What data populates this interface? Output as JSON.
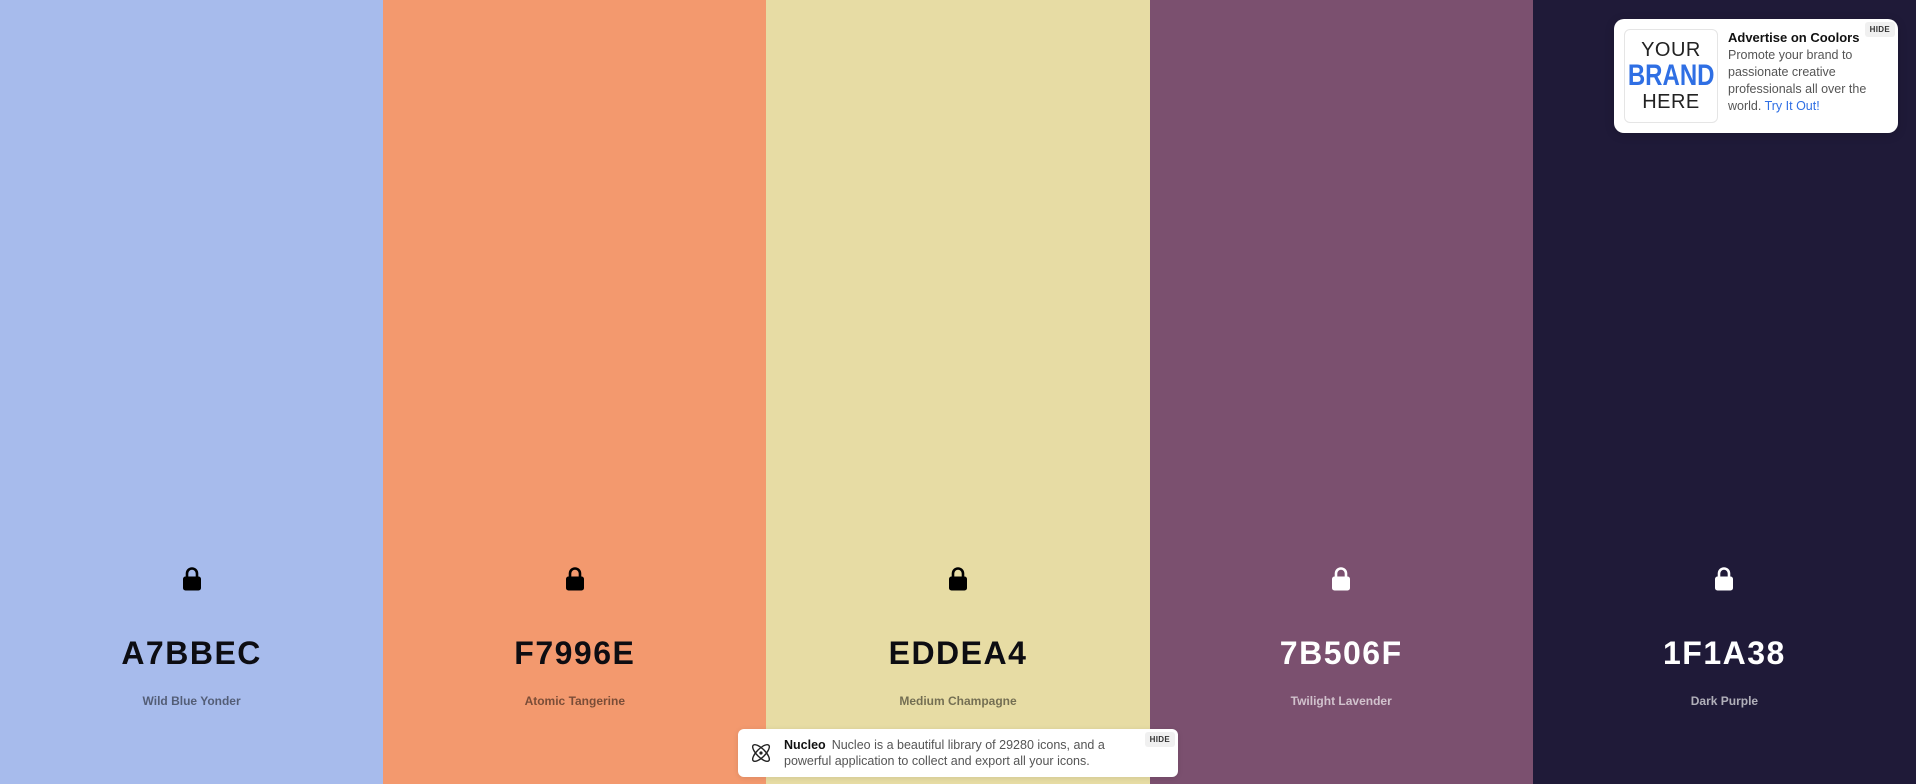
{
  "palette": {
    "swatches": [
      {
        "hex": "A7BBEC",
        "name": "Wild Blue Yonder",
        "color": "#A7BBEC",
        "text_theme": "dark",
        "locked": false
      },
      {
        "hex": "F7996E",
        "name": "Atomic Tangerine",
        "color": "#F3996E",
        "text_theme": "dark",
        "locked": false
      },
      {
        "hex": "EDDEA4",
        "name": "Medium Champagne",
        "color": "#E7DCA4",
        "text_theme": "dark",
        "locked": false
      },
      {
        "hex": "7B506F",
        "name": "Twilight Lavender",
        "color": "#7B506F",
        "text_theme": "light",
        "locked": false
      },
      {
        "hex": "1F1A38",
        "name": "Dark Purple",
        "color": "#1F1A38",
        "text_theme": "light",
        "locked": false
      }
    ]
  },
  "ad": {
    "brand_line1": "YOUR",
    "brand_line2": "BRAND",
    "brand_line3": "HERE",
    "title": "Advertise on Coolors",
    "text": "Promote your brand to passionate creative professionals all over the world.",
    "link": "Try It Out!",
    "hide_label": "HIDE"
  },
  "notice": {
    "title": "Nucleo",
    "text": "Nucleo is a beautiful library of 29280 icons, and a powerful application to collect and export all your icons.",
    "hide_label": "HIDE",
    "icon": "nucleo-atom-icon"
  }
}
